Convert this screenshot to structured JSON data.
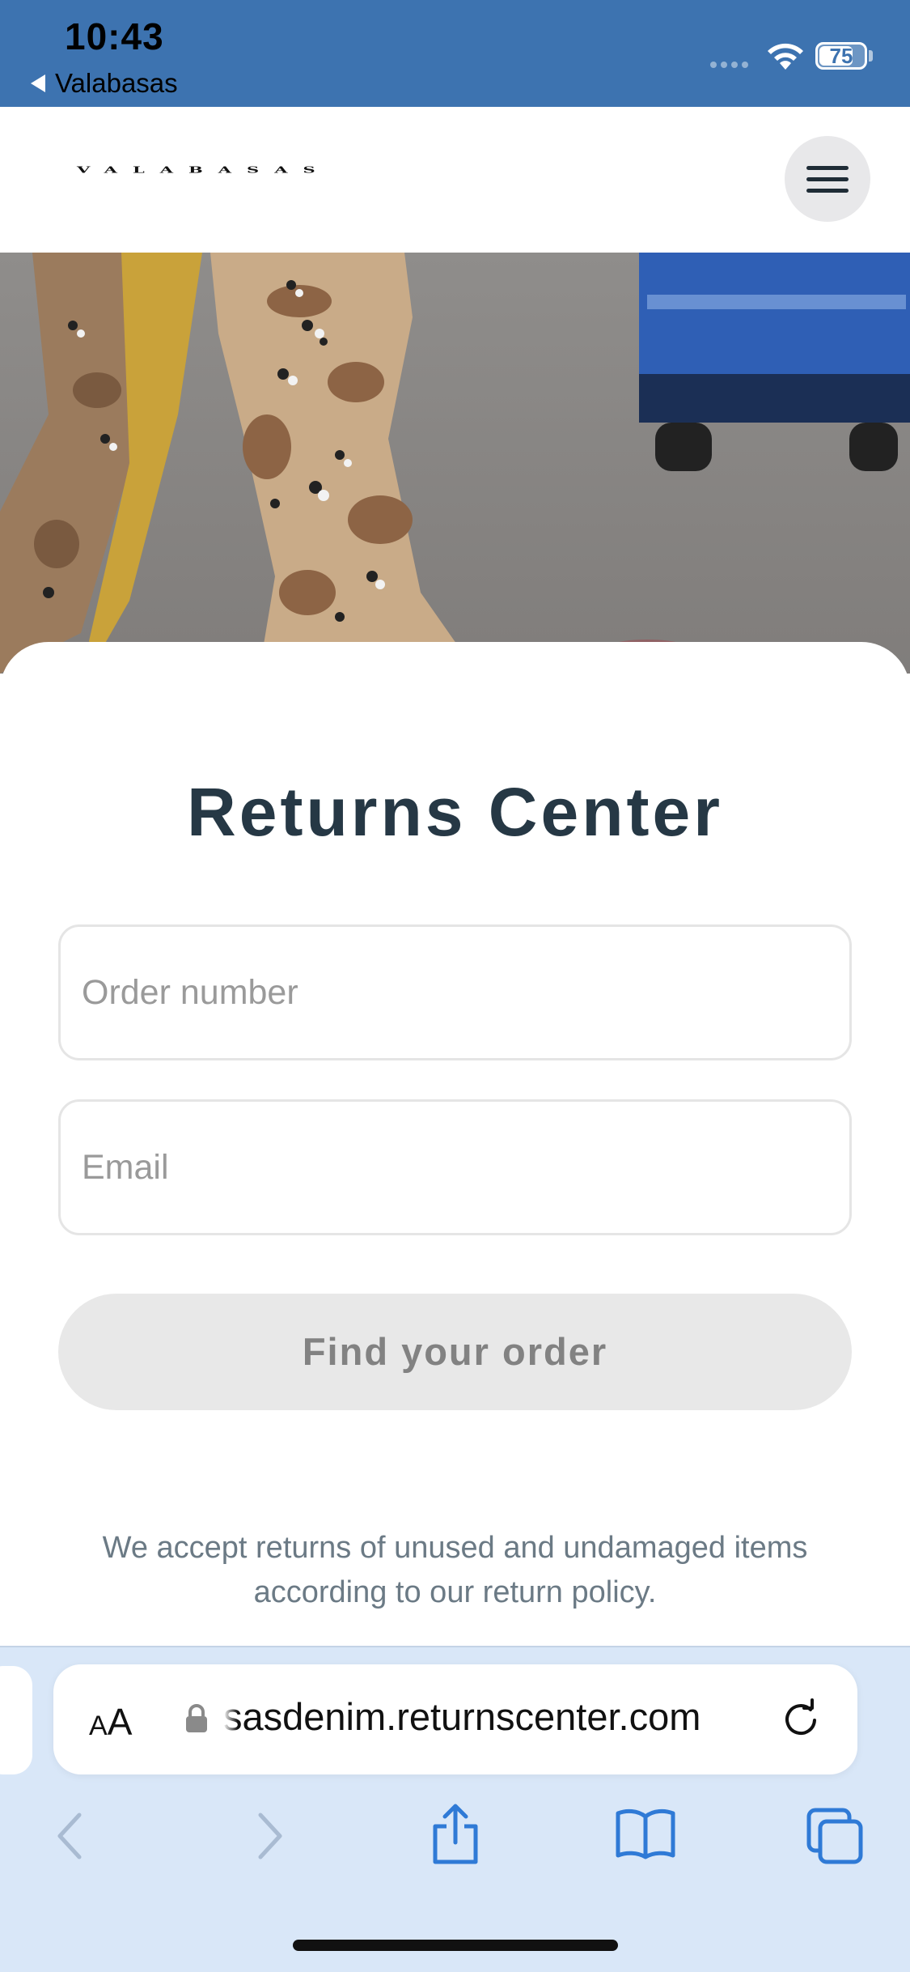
{
  "status_bar": {
    "time": "10:43",
    "back_app": "Valabasas",
    "battery": "75",
    "battery_level": 0.75
  },
  "header": {
    "logo_text": "VALABASAS"
  },
  "returns": {
    "title": "Returns Center",
    "order_placeholder": "Order number",
    "email_placeholder": "Email",
    "find_button": "Find your order",
    "policy_text": "We accept returns of unused and undamaged items according to our return policy."
  },
  "browser": {
    "aa_small": "A",
    "aa_big": "A",
    "url": "asdenim.returnscenter.com",
    "url_truncated_prefix": "s"
  },
  "colors": {
    "status_bar": "#3d73b0",
    "title": "#263845",
    "button_bg": "#e8e8e8",
    "browser_bg": "#d9e7f8",
    "toolbar_icon": "#2f7ad6"
  }
}
